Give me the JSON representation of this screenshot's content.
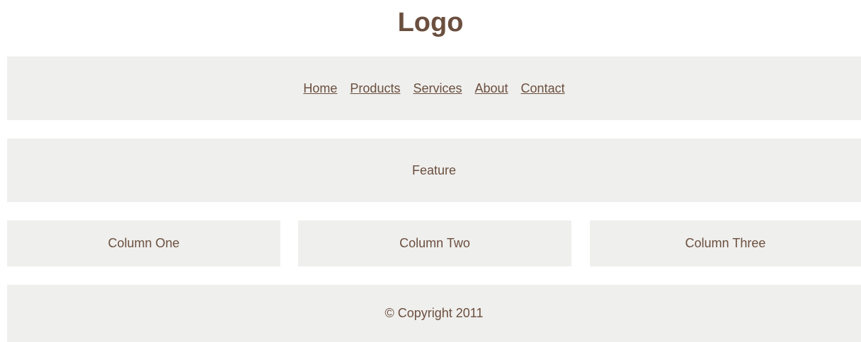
{
  "header": {
    "logo": "Logo"
  },
  "nav": {
    "items": [
      {
        "label": "Home"
      },
      {
        "label": "Products"
      },
      {
        "label": "Services"
      },
      {
        "label": "About"
      },
      {
        "label": "Contact"
      }
    ]
  },
  "feature": {
    "label": "Feature"
  },
  "columns": [
    {
      "label": "Column One"
    },
    {
      "label": "Column Two"
    },
    {
      "label": "Column Three"
    }
  ],
  "footer": {
    "copyright": "© Copyright 2011"
  },
  "colors": {
    "text": "#6b4f3f",
    "panel_background": "#efefed",
    "page_background": "#ffffff"
  }
}
